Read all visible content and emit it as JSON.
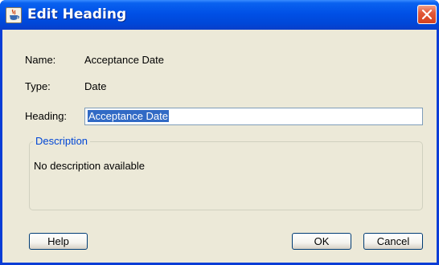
{
  "window": {
    "title": "Edit Heading"
  },
  "fields": {
    "name_label": "Name:",
    "name_value": "Acceptance Date",
    "type_label": "Type:",
    "type_value": "Date",
    "heading_label": "Heading:",
    "heading_value": "Acceptance Date"
  },
  "description": {
    "title": "Description",
    "text": "No description available"
  },
  "buttons": {
    "help": "Help",
    "ok": "OK",
    "cancel": "Cancel"
  },
  "icons": {
    "app": "java-cup-icon",
    "close": "close-icon"
  },
  "colors": {
    "titlebar": "#0050e6",
    "client_bg": "#ece9d8",
    "selection": "#316ac5",
    "group_title": "#0046d5",
    "close_button": "#d4421f"
  }
}
